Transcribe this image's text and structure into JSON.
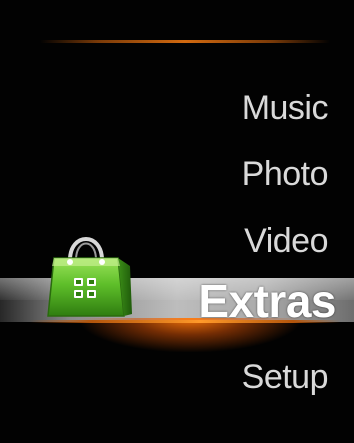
{
  "menu": {
    "items": [
      {
        "label": "Music",
        "selected": false
      },
      {
        "label": "Photo",
        "selected": false
      },
      {
        "label": "Video",
        "selected": false
      },
      {
        "label": "Extras",
        "selected": true
      },
      {
        "label": "Setup",
        "selected": false
      }
    ]
  },
  "icons": {
    "selected_item_icon": "shopping-bag-apps-icon"
  },
  "colors": {
    "background": "#000000",
    "text": "#d9d9d9",
    "selected_text": "#ffffff",
    "accent": "#ff8a1a",
    "icon_green": "#5fbf2a"
  }
}
